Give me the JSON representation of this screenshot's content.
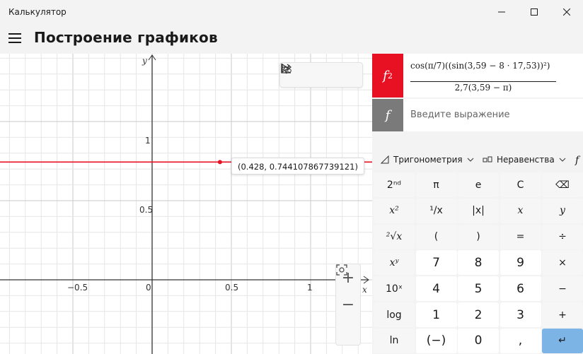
{
  "window": {
    "title": "Калькулятор"
  },
  "header": {
    "title": "Построение графиков"
  },
  "graph": {
    "x_axis_name": "x",
    "y_axis_name": "y",
    "x_ticks": [
      "−0.5",
      "0",
      "0.5",
      "1"
    ],
    "y_ticks": [
      "1",
      "0.5"
    ],
    "trace_value": "(0.428, 0.744107867739121)",
    "curve_y": 0.744107867739121,
    "trace_x": 0.428,
    "curve_color": "#e81123"
  },
  "functions": [
    {
      "tag": "f",
      "sub": "2",
      "numerator": "cos(π/7)((sin(3,59 − 8 · 17,53))²)",
      "denominator": "2,7(3,59 − π)",
      "color": "#e81123"
    },
    {
      "tag": "f",
      "placeholder": "Введите выражение",
      "color": "#7a7a7a"
    }
  ],
  "dropdowns": {
    "trig": "Тригонометрия",
    "ineq": "Неравенства",
    "func": "f"
  },
  "keys": [
    [
      "2ⁿᵈ",
      "π",
      "e",
      "C",
      "⌫"
    ],
    [
      "x²",
      "¹/x",
      "|x|",
      "x",
      "y"
    ],
    [
      "²√x",
      "(",
      ")",
      "=",
      "÷"
    ],
    [
      "xʸ",
      "7",
      "8",
      "9",
      "×"
    ],
    [
      "10ˣ",
      "4",
      "5",
      "6",
      "−"
    ],
    [
      "log",
      "1",
      "2",
      "3",
      "+"
    ],
    [
      "ln",
      "(−)",
      "0",
      ",",
      "↵"
    ]
  ]
}
